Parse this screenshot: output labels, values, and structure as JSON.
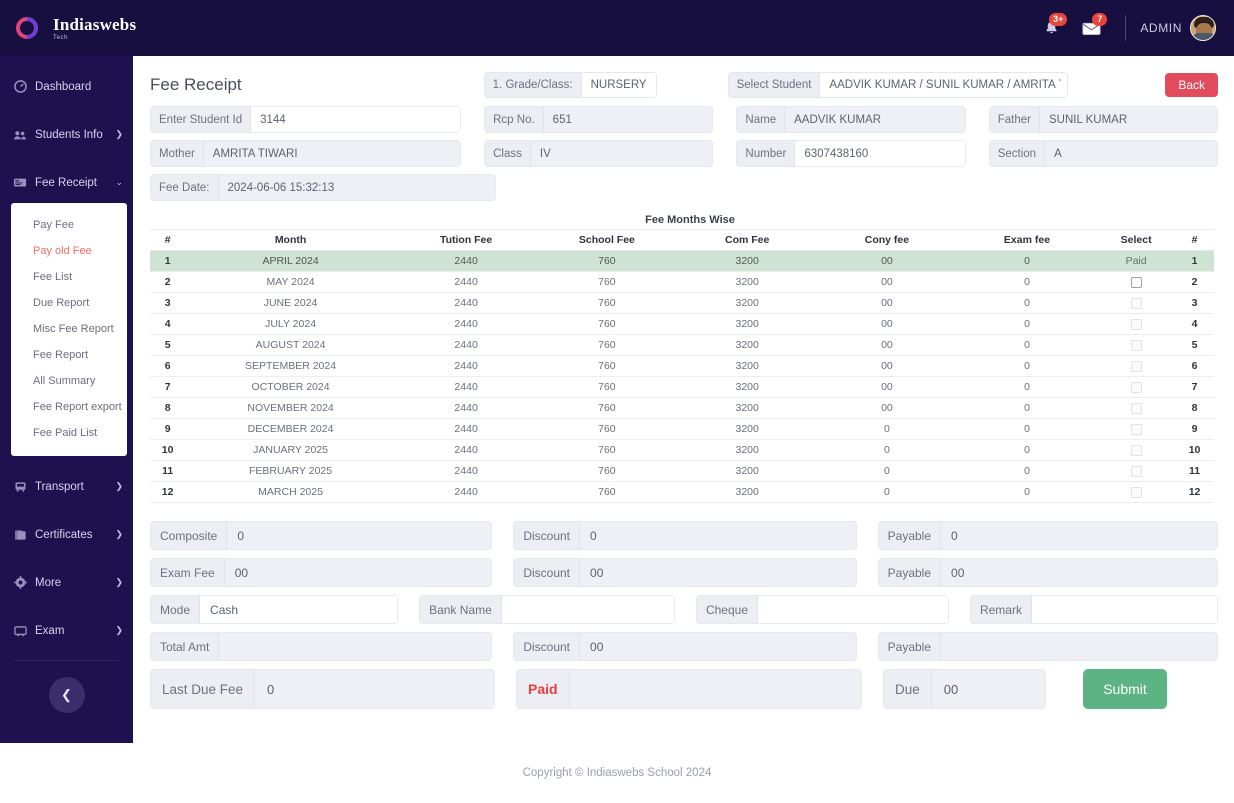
{
  "brand": {
    "name": "Indiaswebs",
    "sub": "Tech",
    "logo_icon": "ring-logo-icon"
  },
  "topbar": {
    "notifications_badge": "3+",
    "messages_badge": "7",
    "user_label": "ADMIN",
    "bell_icon": "bell-icon",
    "mail_icon": "envelope-icon",
    "avatar_icon": "user-avatar"
  },
  "sidebar": {
    "items": [
      {
        "label": "Dashboard",
        "icon": "dashboard-icon",
        "caret": "",
        "key": "dashboard"
      },
      {
        "label": "Students Info",
        "icon": "users-icon",
        "caret": "❯",
        "key": "students-info"
      },
      {
        "label": "Fee Receipt",
        "icon": "receipt-icon",
        "caret": "⌄",
        "key": "fee-receipt"
      }
    ],
    "submenu": [
      {
        "label": "Pay Fee",
        "key": "pay-fee",
        "active": false
      },
      {
        "label": "Pay old Fee",
        "key": "pay-old-fee",
        "active": true
      },
      {
        "label": "Fee List",
        "key": "fee-list",
        "active": false
      },
      {
        "label": "Due Report",
        "key": "due-report",
        "active": false
      },
      {
        "label": "Misc Fee Report",
        "key": "misc-fee-report",
        "active": false
      },
      {
        "label": "Fee Report",
        "key": "fee-report",
        "active": false
      },
      {
        "label": "All Summary",
        "key": "all-summary",
        "active": false
      },
      {
        "label": "Fee Report export",
        "key": "fee-report-export",
        "active": false
      },
      {
        "label": "Fee Paid List",
        "key": "fee-paid-list",
        "active": false
      }
    ],
    "items_bottom": [
      {
        "label": "Transport",
        "icon": "bus-icon",
        "caret": "❯",
        "key": "transport"
      },
      {
        "label": "Certificates",
        "icon": "certificate-icon",
        "caret": "❯",
        "key": "certificates"
      },
      {
        "label": "More",
        "icon": "gear-icon",
        "caret": "❯",
        "key": "more"
      },
      {
        "label": "Exam",
        "icon": "exam-icon",
        "caret": "❯",
        "key": "exam"
      }
    ],
    "collapse_icon": "chevron-left-icon"
  },
  "page": {
    "title": "Fee Receipt",
    "grade_label": "1. Grade/Class:",
    "grade_value": "NURSERY",
    "select_student_label": "Select Student",
    "select_student_value": "AADVIK KUMAR / SUNIL KUMAR / AMRITA `",
    "back_label": "Back"
  },
  "form": {
    "student_id_label": "Enter Student Id",
    "student_id_value": "3144",
    "rcp_no_label": "Rcp No.",
    "rcp_no_value": "651",
    "name_label": "Name",
    "name_value": "AADVIK KUMAR",
    "father_label": "Father",
    "father_value": "SUNIL KUMAR",
    "mother_label": "Mother",
    "mother_value": "AMRITA TIWARI",
    "class_label": "Class",
    "class_value": "IV",
    "number_label": "Number",
    "number_value": "6307438160",
    "section_label": "Section",
    "section_value": "A",
    "fee_date_label": "Fee Date:",
    "fee_date_value": "2024-06-06 15:32:13"
  },
  "fee_table": {
    "caption": "Fee Months Wise",
    "columns": [
      "#",
      "Month",
      "Tution Fee",
      "School Fee",
      "Com Fee",
      "Cony fee",
      "Exam fee",
      "Select",
      "#"
    ],
    "rows": [
      {
        "idx": "1",
        "month": "APRIL 2024",
        "tution": "2440",
        "school": "760",
        "com": "3200",
        "cony": "00",
        "exam": "0",
        "select": "Paid",
        "idx2": "1",
        "paid": true,
        "checkbox": false,
        "checkbox_dim": false
      },
      {
        "idx": "2",
        "month": "MAY 2024",
        "tution": "2440",
        "school": "760",
        "com": "3200",
        "cony": "00",
        "exam": "0",
        "select": "",
        "idx2": "2",
        "paid": false,
        "checkbox": true,
        "checkbox_dim": false
      },
      {
        "idx": "3",
        "month": "JUNE 2024",
        "tution": "2440",
        "school": "760",
        "com": "3200",
        "cony": "00",
        "exam": "0",
        "select": "",
        "idx2": "3",
        "paid": false,
        "checkbox": true,
        "checkbox_dim": true
      },
      {
        "idx": "4",
        "month": "JULY 2024",
        "tution": "2440",
        "school": "760",
        "com": "3200",
        "cony": "00",
        "exam": "0",
        "select": "",
        "idx2": "4",
        "paid": false,
        "checkbox": true,
        "checkbox_dim": true
      },
      {
        "idx": "5",
        "month": "AUGUST 2024",
        "tution": "2440",
        "school": "760",
        "com": "3200",
        "cony": "00",
        "exam": "0",
        "select": "",
        "idx2": "5",
        "paid": false,
        "checkbox": true,
        "checkbox_dim": true
      },
      {
        "idx": "6",
        "month": "SEPTEMBER 2024",
        "tution": "2440",
        "school": "760",
        "com": "3200",
        "cony": "00",
        "exam": "0",
        "select": "",
        "idx2": "6",
        "paid": false,
        "checkbox": true,
        "checkbox_dim": true
      },
      {
        "idx": "7",
        "month": "OCTOBER 2024",
        "tution": "2440",
        "school": "760",
        "com": "3200",
        "cony": "00",
        "exam": "0",
        "select": "",
        "idx2": "7",
        "paid": false,
        "checkbox": true,
        "checkbox_dim": true
      },
      {
        "idx": "8",
        "month": "NOVEMBER 2024",
        "tution": "2440",
        "school": "760",
        "com": "3200",
        "cony": "00",
        "exam": "0",
        "select": "",
        "idx2": "8",
        "paid": false,
        "checkbox": true,
        "checkbox_dim": true
      },
      {
        "idx": "9",
        "month": "DECEMBER 2024",
        "tution": "2440",
        "school": "760",
        "com": "3200",
        "cony": "0",
        "exam": "0",
        "select": "",
        "idx2": "9",
        "paid": false,
        "checkbox": true,
        "checkbox_dim": true
      },
      {
        "idx": "10",
        "month": "JANUARY 2025",
        "tution": "2440",
        "school": "760",
        "com": "3200",
        "cony": "0",
        "exam": "0",
        "select": "",
        "idx2": "10",
        "paid": false,
        "checkbox": true,
        "checkbox_dim": true
      },
      {
        "idx": "11",
        "month": "FEBRUARY 2025",
        "tution": "2440",
        "school": "760",
        "com": "3200",
        "cony": "0",
        "exam": "0",
        "select": "",
        "idx2": "11",
        "paid": false,
        "checkbox": true,
        "checkbox_dim": true
      },
      {
        "idx": "12",
        "month": "MARCH 2025",
        "tution": "2440",
        "school": "760",
        "com": "3200",
        "cony": "0",
        "exam": "0",
        "select": "",
        "idx2": "12",
        "paid": false,
        "checkbox": true,
        "checkbox_dim": true
      }
    ]
  },
  "payment": {
    "composite_label": "Composite",
    "composite_value": "0",
    "composite_discount_label": "Discount",
    "composite_discount_value": "0",
    "composite_payable_label": "Payable",
    "composite_payable_value": "0",
    "exam_fee_label": "Exam Fee",
    "exam_fee_value": "00",
    "exam_discount_label": "Discount",
    "exam_discount_value": "00",
    "exam_payable_label": "Payable",
    "exam_payable_value": "00",
    "mode_label": "Mode",
    "mode_value": "Cash",
    "bank_label": "Bank Name",
    "bank_value": "",
    "cheque_label": "Cheque",
    "cheque_value": "",
    "remark_label": "Remark",
    "remark_value": "",
    "total_amt_label": "Total Amt",
    "total_amt_value": "",
    "total_discount_label": "Discount",
    "total_discount_value": "00",
    "total_payable_label": "Payable",
    "total_payable_value": "",
    "last_due_label": "Last Due Fee",
    "last_due_value": "0",
    "paid_label": "Paid",
    "paid_value": "",
    "due_label": "Due",
    "due_value": "00",
    "submit_label": "Submit"
  },
  "footer": {
    "copyright": "Copyright © Indiaswebs School 2024"
  },
  "colors": {
    "topbar": "#160f3f",
    "sidebar": "#1d1150",
    "accent_red": "#e24b5b",
    "active_menu": "#f07167",
    "paid_row": "#cfe3d4",
    "submit_green": "#5cb383",
    "badge_red": "#e8453c"
  }
}
